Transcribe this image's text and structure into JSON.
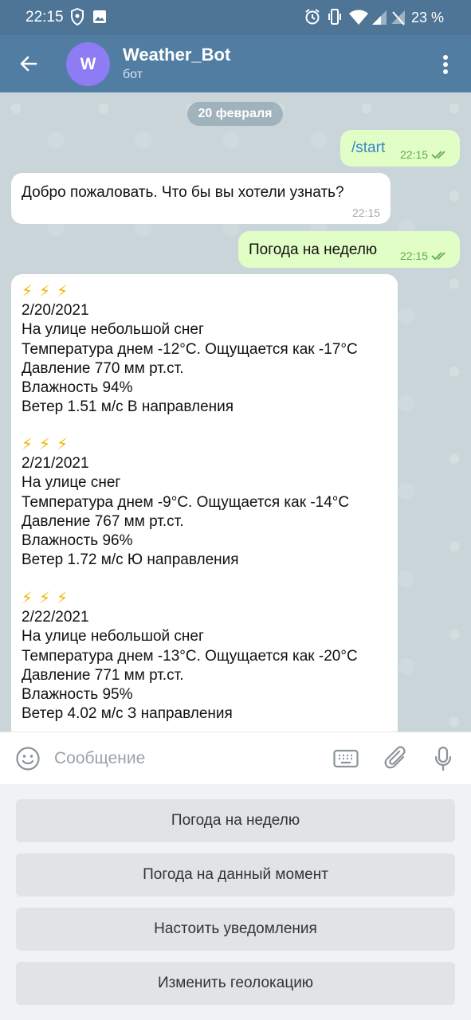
{
  "status_bar": {
    "time": "22:15",
    "battery": "23 %"
  },
  "header": {
    "avatar_letter": "W",
    "title": "Weather_Bot",
    "subtitle": "бот"
  },
  "chat": {
    "date": "20 февраля",
    "messages": [
      {
        "direction": "out",
        "text": "/start",
        "time": "22:15",
        "read": true
      },
      {
        "direction": "in",
        "text": "Добро пожаловать. Что бы вы хотели узнать?",
        "time": "22:15"
      },
      {
        "direction": "out",
        "text": "Погода на неделю",
        "time": "22:15",
        "read": true
      }
    ],
    "forecast": [
      {
        "bolts": "⚡⚡⚡",
        "date": "2/20/2021",
        "condition": "На улице небольшой снег",
        "temperature": "Температура днем -12°C. Ощущается как -17°C",
        "pressure": "Давление 770 мм рт.ст.",
        "humidity": "Влажность 94%",
        "wind": "Ветер 1.51 м/с В направления"
      },
      {
        "bolts": "⚡⚡⚡",
        "date": "2/21/2021",
        "condition": "На улице снег",
        "temperature": "Температура днем -9°C. Ощущается как -14°C",
        "pressure": "Давление 767 мм рт.ст.",
        "humidity": "Влажность 96%",
        "wind": "Ветер 1.72 м/с Ю направления"
      },
      {
        "bolts": "⚡⚡⚡",
        "date": "2/22/2021",
        "condition": "На улице небольшой снег",
        "temperature": "Температура днем -13°C. Ощущается как -20°C",
        "pressure": "Давление 771 мм рт.ст.",
        "humidity": "Влажность 95%",
        "wind": "Ветер 4.02 м/с З направления"
      }
    ]
  },
  "input": {
    "placeholder": "Сообщение"
  },
  "keyboard": {
    "buttons": [
      "Погода на неделю",
      "Погода на данный момент",
      "Настоить уведомления",
      "Изменить геолокацию"
    ]
  },
  "colors": {
    "header": "#527da3",
    "status_bar": "#4e7596",
    "outgoing_bubble": "#e1fec6",
    "incoming_bubble": "#ffffff",
    "avatar": "#8e7cf4",
    "bolt": "#f4b400"
  }
}
